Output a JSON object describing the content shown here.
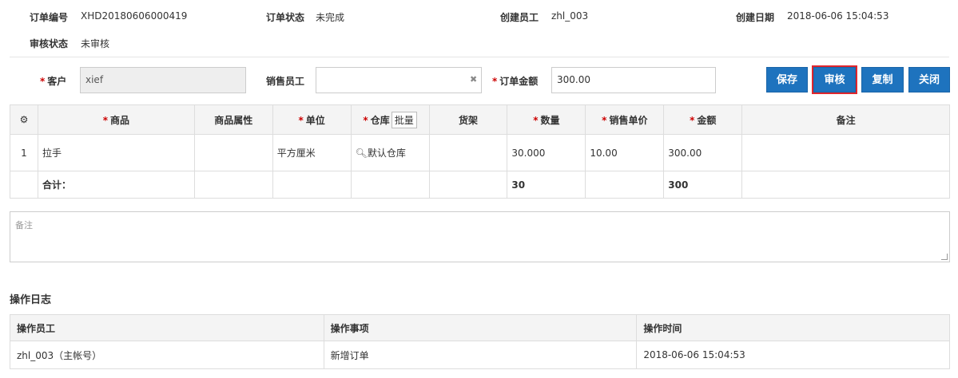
{
  "info": {
    "order_no_label": "订单编号",
    "order_no": "XHD20180606000419",
    "order_status_label": "订单状态",
    "order_status": "未完成",
    "creator_label": "创建员工",
    "creator": "zhl_003",
    "created_date_label": "创建日期",
    "created_date": "2018-06-06 15:04:53",
    "audit_status_label": "审核状态",
    "audit_status": "未审核"
  },
  "form": {
    "customer_label": "客户",
    "customer_value": "xief",
    "sales_label": "销售员工",
    "sales_value": "",
    "amount_label": "订单金额",
    "amount_value": "300.00",
    "required_mark": "*"
  },
  "buttons": {
    "save": "保存",
    "audit": "审核",
    "copy": "复制",
    "close": "关闭"
  },
  "grid": {
    "headers": {
      "product": "商品",
      "attr": "商品属性",
      "unit": "单位",
      "warehouse": "仓库",
      "batch": "批量",
      "shelf": "货架",
      "qty": "数量",
      "price": "销售单价",
      "amount": "金额",
      "remark": "备注"
    },
    "rows": [
      {
        "index": "1",
        "product": "拉手",
        "attr": "",
        "unit": "平方厘米",
        "warehouse": "默认仓库",
        "shelf": "",
        "qty": "30.000",
        "price": "10.00",
        "amount": "300.00",
        "remark": ""
      }
    ],
    "total": {
      "label": "合计：",
      "qty": "30",
      "amount": "300"
    }
  },
  "remark": {
    "placeholder": "备注"
  },
  "log": {
    "title": "操作日志",
    "headers": {
      "operator": "操作员工",
      "action": "操作事项",
      "time": "操作时间"
    },
    "rows": [
      {
        "operator": "zhl_003（主帐号）",
        "action": "新增订单",
        "time": "2018-06-06 15:04:53"
      }
    ]
  },
  "icons": {
    "settings": "gear-icon",
    "search": "search-icon",
    "clear": "close-icon"
  },
  "colors": {
    "primary": "#1e73be",
    "highlight": "#e0262d",
    "required": "#cc0000"
  }
}
